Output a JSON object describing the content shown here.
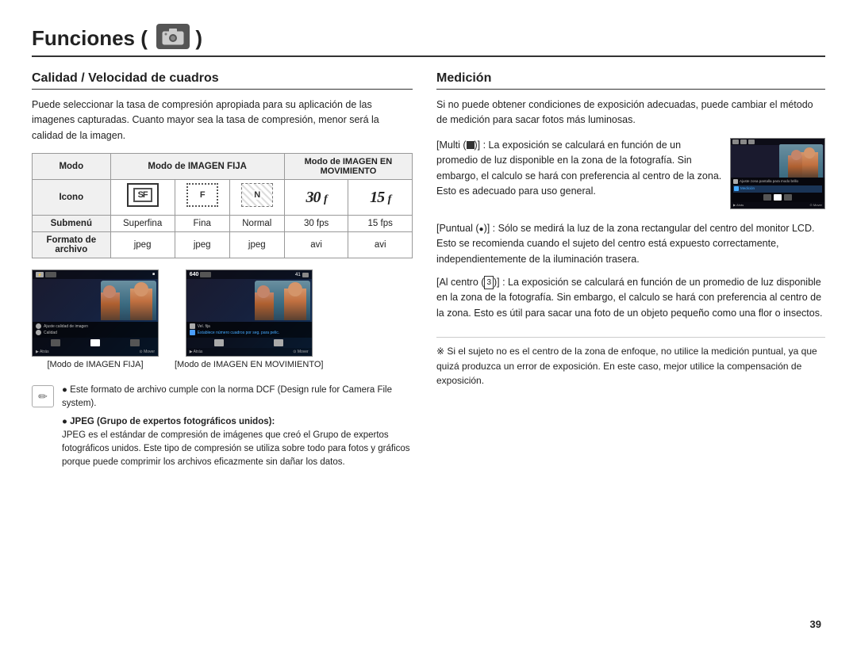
{
  "header": {
    "title": "Funciones (",
    "title_end": ")",
    "camera_icon": "📷"
  },
  "left_section": {
    "title": "Calidad / Velocidad de cuadros",
    "intro": "Puede seleccionar la tasa de compresión apropiada para su aplicación de las imagenes capturadas. Cuanto mayor sea la tasa de compresión, menor será la calidad de la imagen.",
    "table": {
      "headers": [
        "Modo",
        "Modo de IMAGEN FIJA",
        "",
        "",
        "Modo de IMAGEN EN MOVIMIENTO",
        ""
      ],
      "rows": [
        {
          "label": "Icono",
          "cells": [
            "SF-icon",
            "F-icon",
            "N-icon",
            "30fps-icon",
            "15fps-icon"
          ]
        },
        {
          "label": "Submenú",
          "cells": [
            "Superfina",
            "Fina",
            "Normal",
            "30 fps",
            "15 fps"
          ]
        },
        {
          "label": "Formato de archivo",
          "cells": [
            "jpeg",
            "jpeg",
            "jpeg",
            "avi",
            "avi"
          ]
        }
      ]
    },
    "screenshots": [
      {
        "label": "[Modo de IMAGEN FIJA]"
      },
      {
        "label": "[Modo de IMAGEN EN MOVIMIENTO]"
      }
    ],
    "note": {
      "bullets": [
        "Este formato de archivo cumple con la norma DCF (Design rule for Camera File system).",
        "JPEG (Grupo de expertos fotográficos unidos):\nJPEG es el estándar de compresión de imágenes que creó el Grupo de expertos fotográficos unidos. Este tipo de compresión se utiliza sobre todo para fotos y gráficos porque puede comprimir los archivos eficazmente sin dañar los datos."
      ]
    }
  },
  "right_section": {
    "title": "Medición",
    "intro": "Si no puede obtener condiciones de exposición adecuadas, puede cambiar el método de medición para sacar fotos más luminosas.",
    "items": [
      {
        "label": "[Multi (",
        "label_icon": "■",
        "label_end": ")]",
        "text": ": La exposición se calculará en función de un promedio de luz disponible en la zona de la fotografía. Sin embargo, el calculo se hará con preferencia al centro de la zona. Esto es adecuado para uso general."
      },
      {
        "label": "[Puntual (",
        "label_icon": "•",
        "label_end": ")]",
        "text": ": Sólo se medirá la luz de la zona rectangular del centro del monitor LCD. Esto se recomienda cuando el sujeto del centro está expuesto correctamente, independientemente de la iluminación trasera."
      },
      {
        "label": "[Al centro (",
        "label_icon": "3",
        "label_end": ")]",
        "text": ": La exposición se calculará en función de un promedio de luz disponible en la zona de la fotografía. Sin embargo, el calculo se hará con preferencia al centro de la zona. Esto es útil para sacar una foto de un objeto pequeño como una flor o insectos."
      }
    ],
    "warning": "※ Si el sujeto no es el centro de la zona de enfoque, no utilice la medición puntual, ya que quizá produzca un error de exposición. En este caso, mejor utilice la compensación de exposición."
  },
  "page_number": "39"
}
